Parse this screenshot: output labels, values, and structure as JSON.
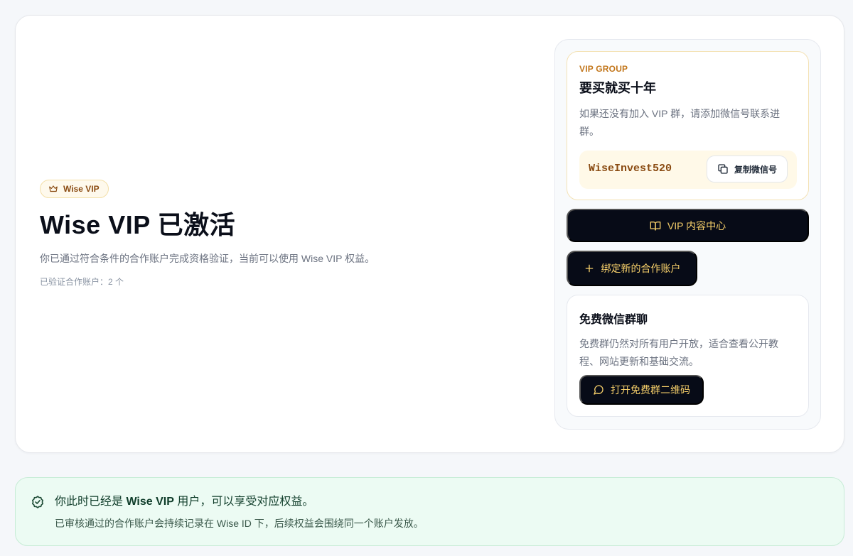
{
  "hero": {
    "badge": "Wise VIP",
    "title": "Wise VIP 已激活",
    "description": "你已通过符合条件的合作账户完成资格验证，当前可以使用 Wise VIP 权益。",
    "verified_accounts": "已验证合作账户：2 个"
  },
  "vip_group": {
    "eyebrow": "VIP GROUP",
    "title": "要买就买十年",
    "description": "如果还没有加入 VIP 群，请添加微信号联系进群。",
    "wechat_id": "WiseInvest520",
    "copy_label": "复制微信号"
  },
  "actions": {
    "content_center": "VIP 内容中心",
    "bind_account": "绑定新的合作账户"
  },
  "free_group": {
    "title": "免费微信群聊",
    "description": "免费群仍然对所有用户开放，适合查看公开教程、网站更新和基础交流。",
    "qr_label": "打开免费群二维码"
  },
  "notice": {
    "title_prefix": "你此时已经是 ",
    "title_strong": "Wise VIP",
    "title_suffix": " 用户，可以享受对应权益。",
    "description": "已审核通过的合作账户会持续记录在 Wise ID 下，后续权益会围绕同一个账户发放。"
  },
  "colors": {
    "accent_gold": "#f6cf6a",
    "dark_button": "#070b17",
    "eyebrow": "#c2761b",
    "success_bg": "#ecfbf3"
  },
  "icons": [
    "crown-icon",
    "copy-icon",
    "book-open-icon",
    "plus-icon",
    "message-circle-icon",
    "shield-check-icon"
  ]
}
